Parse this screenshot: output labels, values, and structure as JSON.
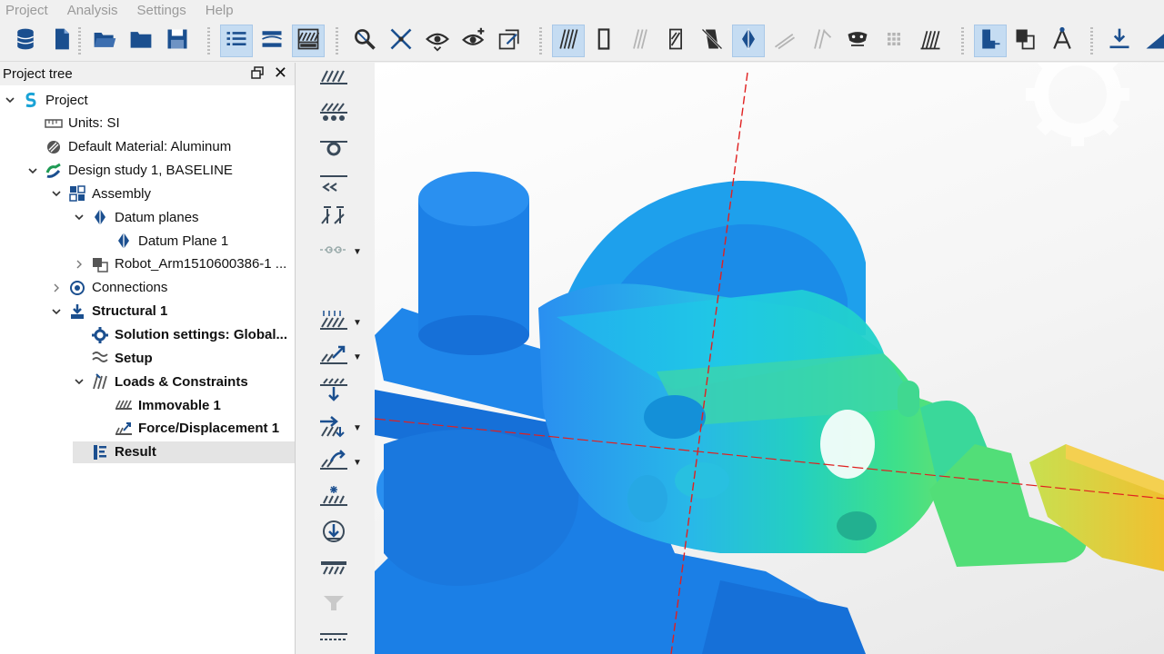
{
  "menu": [
    "Project",
    "Analysis",
    "Settings",
    "Help"
  ],
  "toolbar": {
    "buttons": [
      {
        "name": "database-icon",
        "active": false
      },
      {
        "name": "new-file-icon",
        "active": false
      },
      {
        "name": "open-folder-icon",
        "active": false
      },
      {
        "name": "folder-icon",
        "active": false
      },
      {
        "name": "save-icon",
        "active": false
      },
      {
        "name": "list-view-icon",
        "active": true
      },
      {
        "name": "split-view-icon",
        "active": false
      },
      {
        "name": "results-view-icon",
        "active": true
      },
      {
        "name": "zoom-fit-icon",
        "active": false
      },
      {
        "name": "transform-icon",
        "active": false
      },
      {
        "name": "view-eye-icon",
        "active": false
      },
      {
        "name": "add-view-icon",
        "active": false
      },
      {
        "name": "rotate-view-icon",
        "active": false
      },
      {
        "name": "mesh-hatch-icon",
        "active": true
      },
      {
        "name": "outline-icon",
        "active": false
      },
      {
        "name": "hatch-faded-icon",
        "active": false
      },
      {
        "name": "hatch-slash-icon",
        "active": false
      },
      {
        "name": "hatch-slash-2-icon",
        "active": false
      },
      {
        "name": "datum-plane-icon",
        "active": true
      },
      {
        "name": "gray-tool-1-icon",
        "active": false
      },
      {
        "name": "gray-tool-2-icon",
        "active": false
      },
      {
        "name": "mask-icon",
        "active": false
      },
      {
        "name": "grid-dots-icon",
        "active": false
      },
      {
        "name": "load-arrows-icon",
        "active": false
      },
      {
        "name": "probe-icon",
        "active": true
      },
      {
        "name": "probe-copy-icon",
        "active": false
      },
      {
        "name": "measure-icon",
        "active": false
      },
      {
        "name": "load-down-icon",
        "active": false
      },
      {
        "name": "ramp-icon",
        "active": false
      }
    ]
  },
  "tree": {
    "title": "Project tree",
    "items": [
      {
        "label": "Project",
        "icon": "project-s-icon",
        "level": 0,
        "expand": "open",
        "bold": false
      },
      {
        "label": "Units: SI",
        "icon": "ruler-icon",
        "level": 1,
        "expand": "none",
        "bold": false
      },
      {
        "label": "Default Material: Aluminum",
        "icon": "material-icon",
        "level": 1,
        "expand": "none",
        "bold": false
      },
      {
        "label": "Design study 1, BASELINE",
        "icon": "design-study-icon",
        "level": 1,
        "expand": "open",
        "bold": false
      },
      {
        "label": "Assembly",
        "icon": "assembly-icon",
        "level": 2,
        "expand": "open",
        "bold": false
      },
      {
        "label": "Datum planes",
        "icon": "datum-plane-icon",
        "level": 3,
        "expand": "open",
        "bold": false
      },
      {
        "label": "Datum Plane 1",
        "icon": "datum-plane-icon",
        "level": 4,
        "expand": "none",
        "bold": false
      },
      {
        "label": "Robot_Arm1510600386-1 ...",
        "icon": "part-icon",
        "level": 3,
        "expand": "closed",
        "bold": false
      },
      {
        "label": "Connections",
        "icon": "connections-icon",
        "level": 2,
        "expand": "closed",
        "bold": false
      },
      {
        "label": "Structural 1",
        "icon": "structural-icon",
        "level": 2,
        "expand": "open",
        "bold": true
      },
      {
        "label": "Solution settings: Global...",
        "icon": "gear-icon",
        "level": 3,
        "expand": "none",
        "bold": true
      },
      {
        "label": "Setup",
        "icon": "setup-icon",
        "level": 3,
        "expand": "none",
        "bold": true
      },
      {
        "label": "Loads & Constraints",
        "icon": "loads-icon",
        "level": 3,
        "expand": "open",
        "bold": true
      },
      {
        "label": "Immovable 1",
        "icon": "immovable-icon",
        "level": 4,
        "expand": "none",
        "bold": true
      },
      {
        "label": "Force/Displacement 1",
        "icon": "force-icon",
        "level": 4,
        "expand": "none",
        "bold": true
      },
      {
        "label": "Result",
        "icon": "result-icon",
        "level": 3,
        "expand": "none",
        "bold": true,
        "selected": true
      }
    ]
  },
  "vertical_toolbar": [
    {
      "name": "immovable-constraint-icon",
      "dropdown": false
    },
    {
      "name": "sliding-constraint-icon",
      "dropdown": false
    },
    {
      "name": "pin-constraint-icon",
      "dropdown": false
    },
    {
      "name": "symmetry-constraint-icon",
      "dropdown": false
    },
    {
      "name": "antisymmetry-constraint-icon",
      "dropdown": false
    },
    {
      "name": "connector-icon",
      "dropdown": true
    },
    {
      "name": "force-load-icon",
      "dropdown": true
    },
    {
      "name": "displacement-load-icon",
      "dropdown": true
    },
    {
      "name": "pressure-load-icon",
      "dropdown": false
    },
    {
      "name": "remote-load-icon",
      "dropdown": true
    },
    {
      "name": "moment-load-icon",
      "dropdown": true
    },
    {
      "name": "thermal-load-icon",
      "dropdown": false
    },
    {
      "name": "gravity-load-icon",
      "dropdown": false
    },
    {
      "name": "bearing-load-icon",
      "dropdown": false
    },
    {
      "name": "faded-load-icon",
      "dropdown": false
    },
    {
      "name": "more-load-icon",
      "dropdown": false
    }
  ],
  "colors": {
    "selection": "#c5dcf2",
    "model_blue": "#1e88e8",
    "model_cyan": "#1ec8e0",
    "model_green": "#1edc90",
    "model_yellow": "#e8e038",
    "axis_red": "#e02020"
  }
}
